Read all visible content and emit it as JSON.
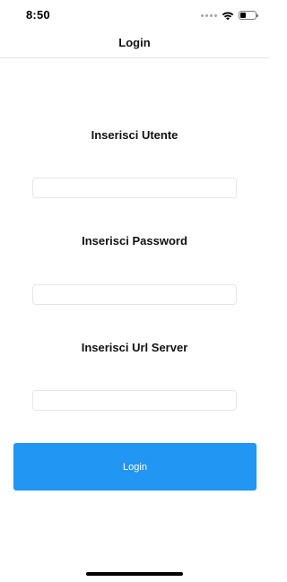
{
  "status_bar": {
    "time": "8:50",
    "icons": [
      "signal-dots-icon",
      "wifi-icon",
      "battery-icon"
    ],
    "battery_level": 0.4
  },
  "header": {
    "title": "Login"
  },
  "form": {
    "user_label": "Inserisci Utente",
    "user_value": "",
    "password_label": "Inserisci Password",
    "password_value": "",
    "server_label": "Inserisci Url Server",
    "server_value": "",
    "login_button_label": "Login"
  },
  "colors": {
    "accent": "#2196f3",
    "background": "#ffffff",
    "border": "#e6e6e6"
  }
}
